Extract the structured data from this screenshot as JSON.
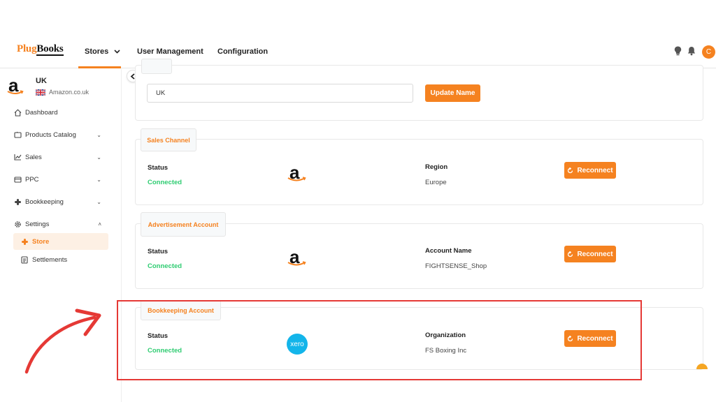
{
  "colors": {
    "accent": "#f58220",
    "connected": "#2ecc71",
    "highlight": "#e53935",
    "xero": "#13b5ea"
  },
  "topnav": {
    "logo_part1": "Plug",
    "logo_part2": "Books",
    "stores_label": "Stores",
    "user_management_label": "User Management",
    "configuration_label": "Configuration",
    "avatar_initial": "C",
    "icons": [
      "lightbulb-icon",
      "bell-icon"
    ]
  },
  "sidebar": {
    "store_name": "UK",
    "marketplace": "Amazon.co.uk",
    "amazon_logo_letter": "a",
    "items": {
      "dashboard": "Dashboard",
      "products": "Products Catalog",
      "sales": "Sales",
      "ppc": "PPC",
      "bookkeeping": "Bookkeeping",
      "settings": "Settings",
      "store": "Store",
      "settlements": "Settlements"
    }
  },
  "main": {
    "store_name_input": "UK",
    "update_name_label": "Update Name",
    "reconnect_label": "Reconnect",
    "sales_channel": {
      "tab": "Sales Channel",
      "status_label": "Status",
      "status_value": "Connected",
      "logo_letter": "a",
      "region_label": "Region",
      "region_value": "Europe"
    },
    "advertisement": {
      "tab": "Advertisement Account",
      "status_label": "Status",
      "status_value": "Connected",
      "logo_letter": "a",
      "account_label": "Account Name",
      "account_value": "FIGHTSENSE_Shop"
    },
    "bookkeeping": {
      "tab": "Bookkeeping Account",
      "status_label": "Status",
      "status_value": "Connected",
      "logo_text": "xero",
      "org_label": "Organization",
      "org_value": "FS Boxing Inc"
    }
  }
}
